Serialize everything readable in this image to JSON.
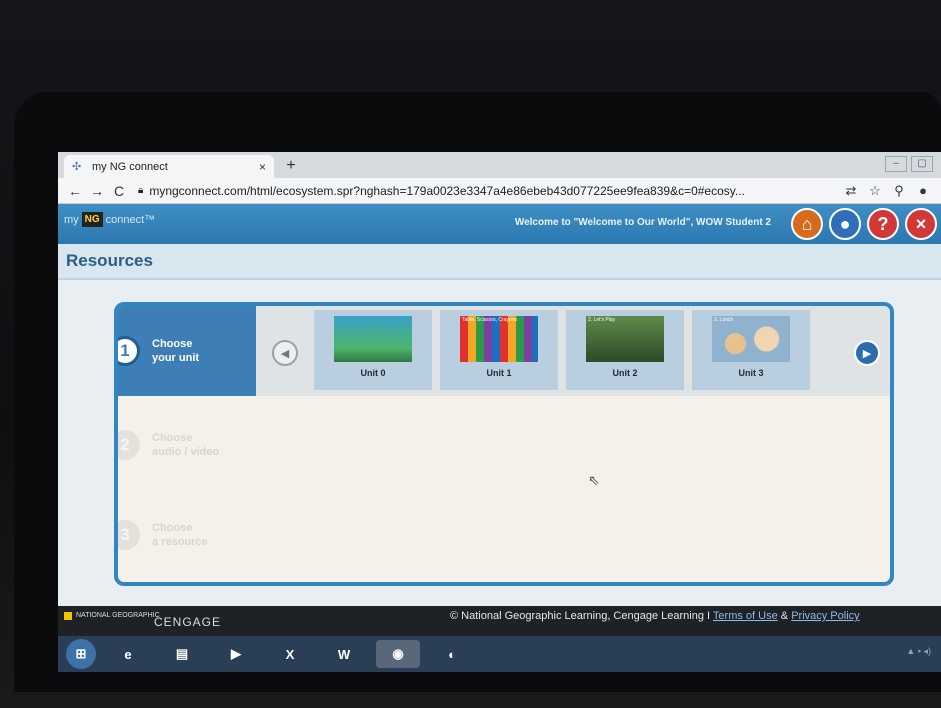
{
  "browser": {
    "tab_title": "my NG connect",
    "tab_close": "×",
    "new_tab": "+",
    "url": "myngconnect.com/html/ecosystem.spr?nghash=179a0023e3347a4e86ebeb43d077225ee9fea839&c=0#ecosy...",
    "nav_back": "←",
    "nav_forward": "→",
    "nav_reload": "C"
  },
  "app": {
    "logo_my": "my",
    "logo_ng": "NG",
    "logo_connect": "connect™",
    "welcome": "Welcome to \"Welcome to Our World\", WOW Student 2",
    "header_buttons": {
      "home": "⌂",
      "user": "●",
      "help": "?",
      "exit": "×"
    }
  },
  "page": {
    "title": "Resources"
  },
  "steps": [
    {
      "num": "1",
      "line1": "Choose",
      "line2": "your unit"
    },
    {
      "num": "2",
      "line1": "Choose",
      "line2": "audio / video"
    },
    {
      "num": "3",
      "line1": "Choose",
      "line2": "a resource"
    }
  ],
  "units": [
    {
      "label": "Unit 0",
      "caption": ""
    },
    {
      "label": "Unit 1",
      "caption": "Table, Scissors, Crayons"
    },
    {
      "label": "Unit 2",
      "caption": "2. Let's Play"
    },
    {
      "label": "Unit 3",
      "caption": "3. Lunch"
    }
  ],
  "footer": {
    "ng": "NATIONAL GEOGRAPHIC",
    "cengage": "CENGAGE",
    "copyright": "© National Geographic Learning, Cengage Learning I",
    "terms": "Terms of Use",
    "amp": "&",
    "privacy": "Privacy Policy"
  },
  "colors": {
    "header_blue": "#2b78b0",
    "panel_border": "#2f86c0",
    "active_step": "#3d7eb6",
    "next_arrow": "#2a6db0"
  }
}
